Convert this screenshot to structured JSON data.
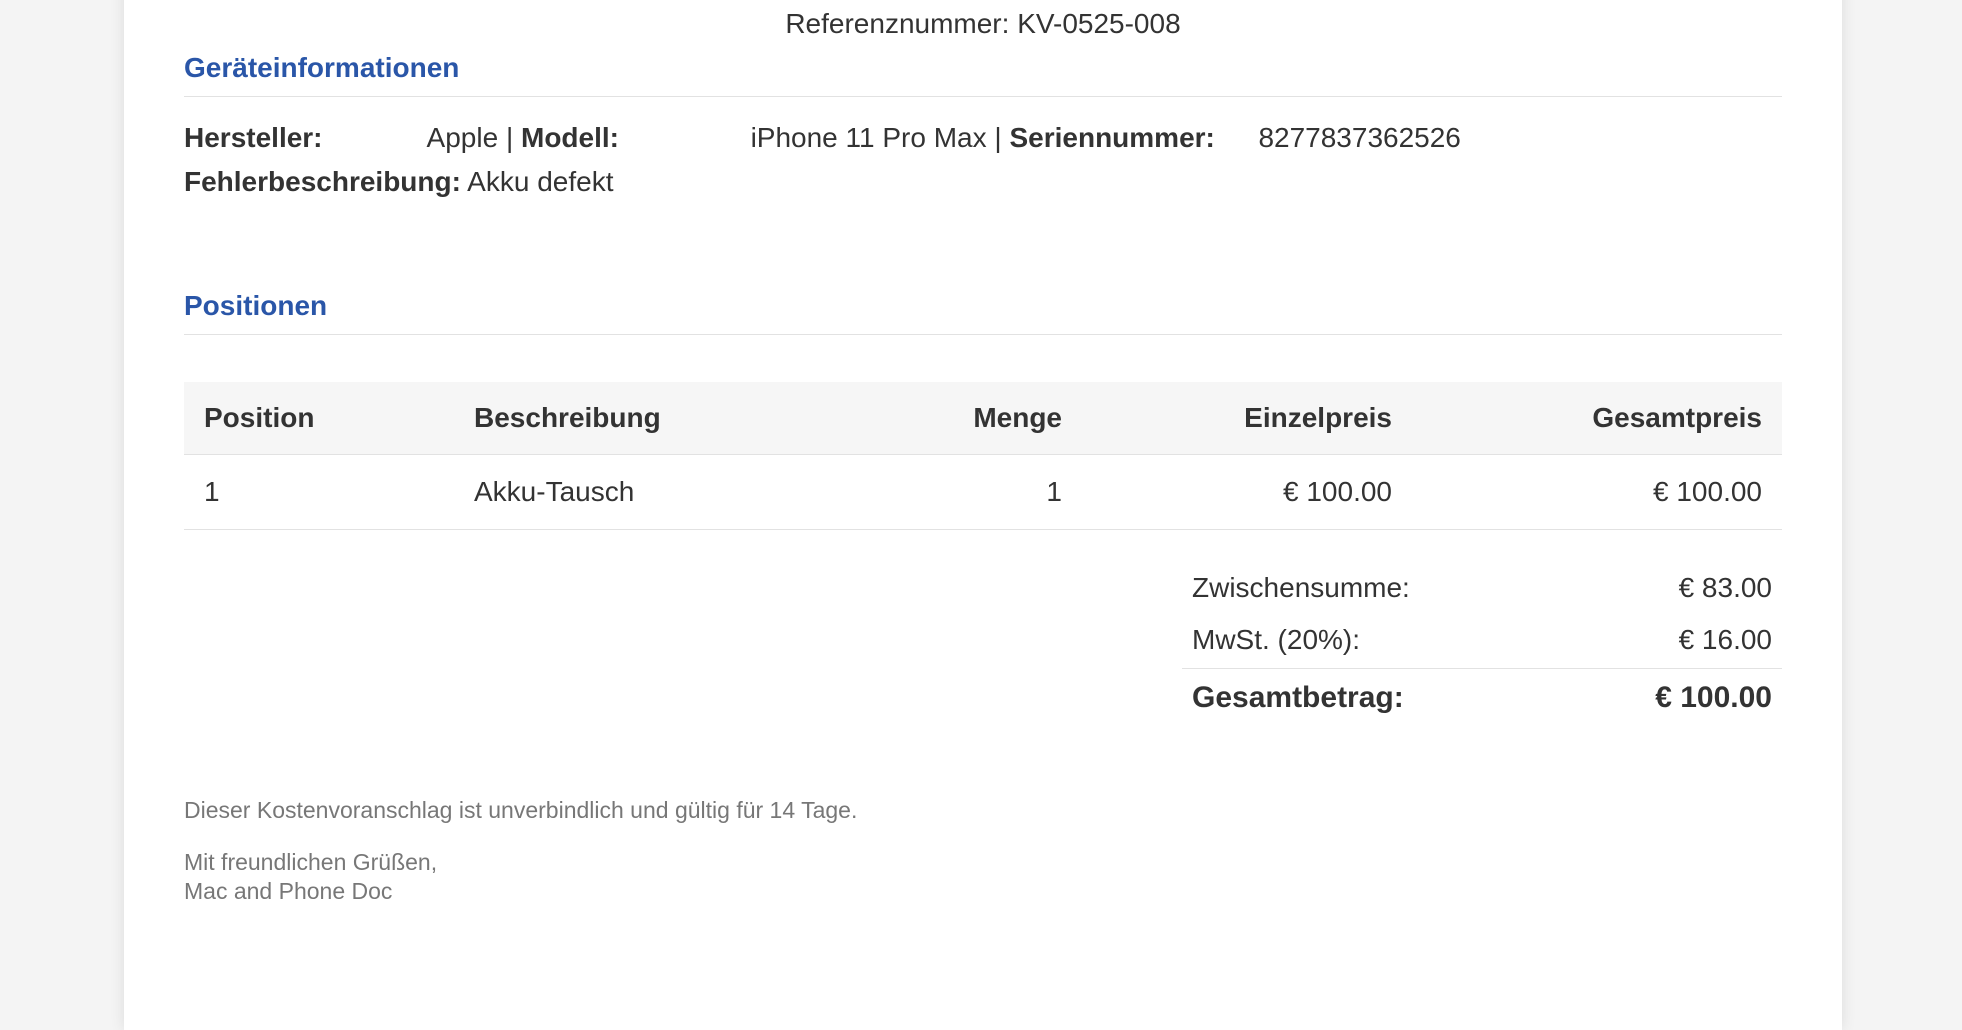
{
  "reference": "Referenznummer: KV-0525-008",
  "device_section": {
    "title": "Geräteinformationen",
    "manufacturer_label": "Hersteller:",
    "manufacturer": "Apple",
    "model_label": "Modell:",
    "model": "iPhone 11 Pro Max",
    "serial_label": "Seriennummer:",
    "serial": "8277837362526",
    "fault_label": "Fehlerbeschreibung:",
    "fault": "Akku defekt",
    "separator": "|"
  },
  "positions_section": {
    "title": "Positionen",
    "headers": [
      "Position",
      "Beschreibung",
      "Menge",
      "Einzelpreis",
      "Gesamtpreis"
    ],
    "rows": [
      [
        "1",
        "Akku-Tausch",
        "1",
        "€ 100.00",
        "€ 100.00"
      ]
    ]
  },
  "totals": {
    "subtotal_label": "Zwischensumme:",
    "subtotal": "€ 83.00",
    "vat_label": "MwSt. (20%):",
    "vat": "€ 16.00",
    "grand_label": "Gesamtbetrag:",
    "grand": "€ 100.00"
  },
  "footer": {
    "disclaimer": "Dieser Kostenvoranschlag ist unverbindlich und gültig für 14 Tage.",
    "greeting": "Mit freundlichen Grüßen,",
    "company": "Mac and Phone Doc"
  }
}
